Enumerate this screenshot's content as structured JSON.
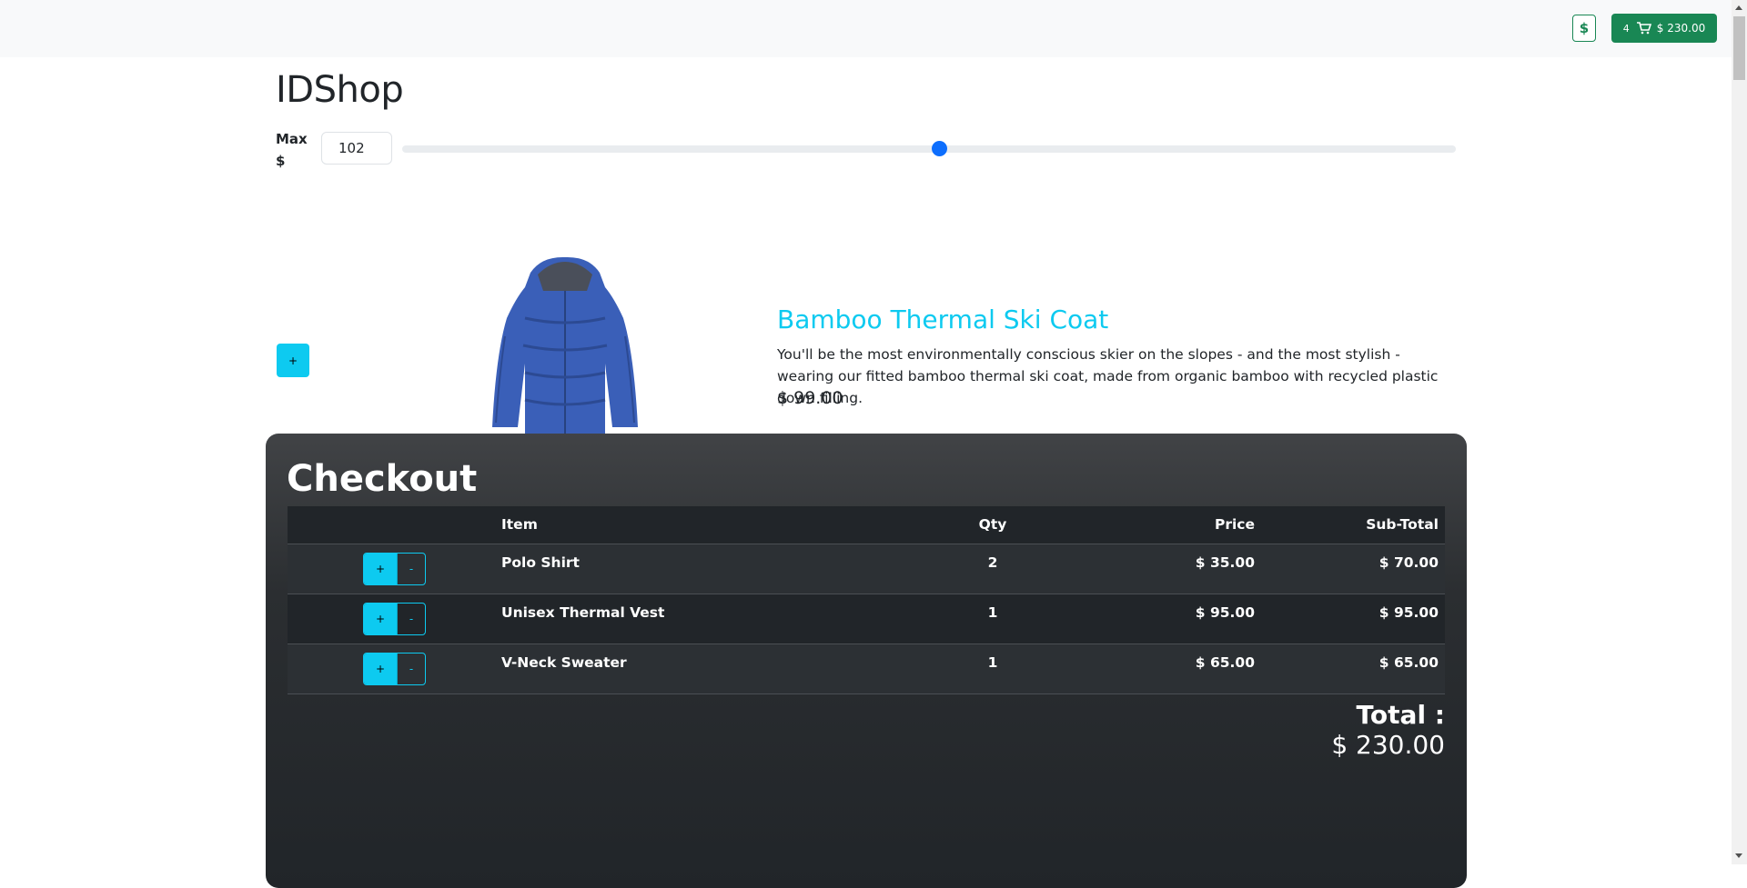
{
  "header": {
    "currency_label": "$",
    "cart_count": "4",
    "cart_total": "$ 230.00"
  },
  "shop": {
    "title": "IDShop",
    "max_label": "Max $",
    "max_value": "102",
    "slider_level": 0.51
  },
  "product": {
    "add_label": "+",
    "name": "Bamboo Thermal Ski Coat",
    "description": "You'll be the most environmentally conscious skier on the slopes - and the most stylish - wearing our fitted bamboo thermal ski coat, made from organic bamboo with recycled plastic down filling.",
    "price": "$ 99.00"
  },
  "checkout": {
    "title": "Checkout",
    "columns": {
      "item": "Item",
      "qty": "Qty",
      "price": "Price",
      "subtotal": "Sub-Total"
    },
    "rows": [
      {
        "item": "Polo Shirt",
        "qty": "2",
        "price": "$ 35.00",
        "subtotal": "$ 70.00",
        "plus": "+",
        "minus": "-"
      },
      {
        "item": "Unisex Thermal Vest",
        "qty": "1",
        "price": "$ 95.00",
        "subtotal": "$ 95.00",
        "plus": "+",
        "minus": "-"
      },
      {
        "item": "V-Neck Sweater",
        "qty": "1",
        "price": "$ 65.00",
        "subtotal": "$ 65.00",
        "plus": "+",
        "minus": "-"
      }
    ],
    "total_label": "Total :",
    "total_value": "$ 230.00"
  },
  "colors": {
    "accent": "#0dcaf0",
    "success": "#198754",
    "primary": "#0d6efd",
    "dark": "#212529"
  }
}
